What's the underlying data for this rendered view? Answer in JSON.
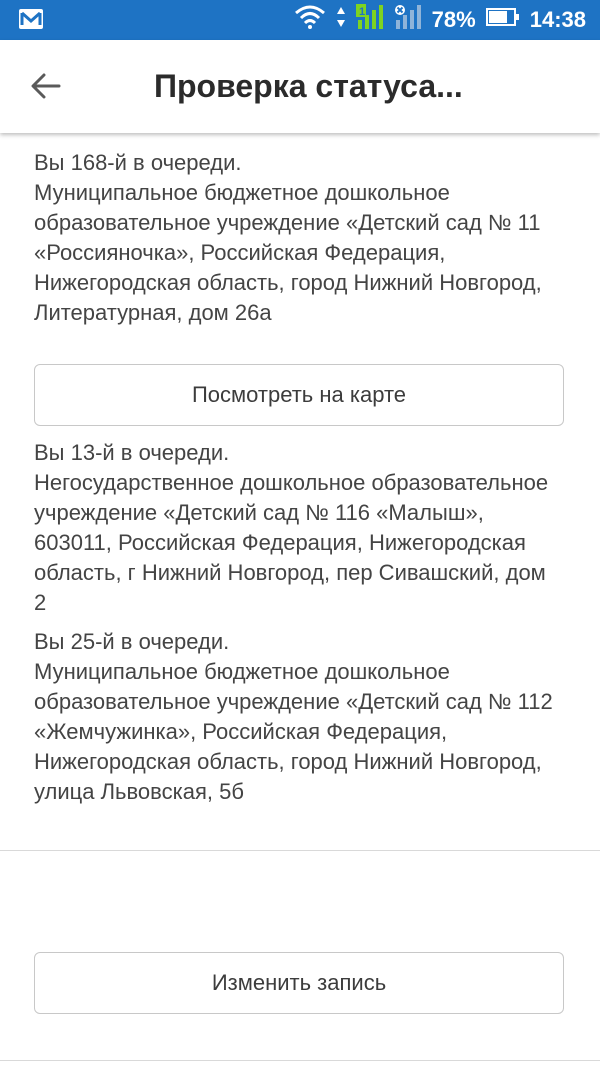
{
  "status_bar": {
    "battery_percent": "78%",
    "time": "14:38",
    "icons": [
      "mail-icon",
      "wifi-icon",
      "cellular-signal-icon",
      "no-signal-icon",
      "battery-icon"
    ]
  },
  "header": {
    "title": "Проверка статуса...",
    "back_icon": "arrow-left-icon"
  },
  "entries": [
    {
      "queue": "Вы 168-й в очереди.",
      "institution": "Муниципальное бюджетное дошкольное образовательное учреждение «Детский сад № 11 «Россияночка», Российская Федерация, Нижегородская область, город Нижний Новгород, Литературная, дом 26а",
      "button_label": "Посмотреть на карте"
    },
    {
      "queue": "Вы 13-й в очереди.",
      "institution": "Негосударственное дошкольное образовательное учреждение «Детский сад № 116 «Малыш», 603011, Российская Федерация, Нижегородская область, г Нижний Новгород, пер Сивашский, дом 2"
    },
    {
      "queue": "Вы 25-й в очереди.",
      "institution": "Муниципальное бюджетное дошкольное образовательное учреждение «Детский сад № 112 «Жемчужинка», Российская Федерация, Нижегородская область, город Нижний Новгород, улица Львовская, 5б"
    }
  ],
  "footer": {
    "edit_button_label": "Изменить запись"
  },
  "colors": {
    "status_bar": "#1e73c4",
    "text": "#444444",
    "signal_green": "#7ed321"
  }
}
